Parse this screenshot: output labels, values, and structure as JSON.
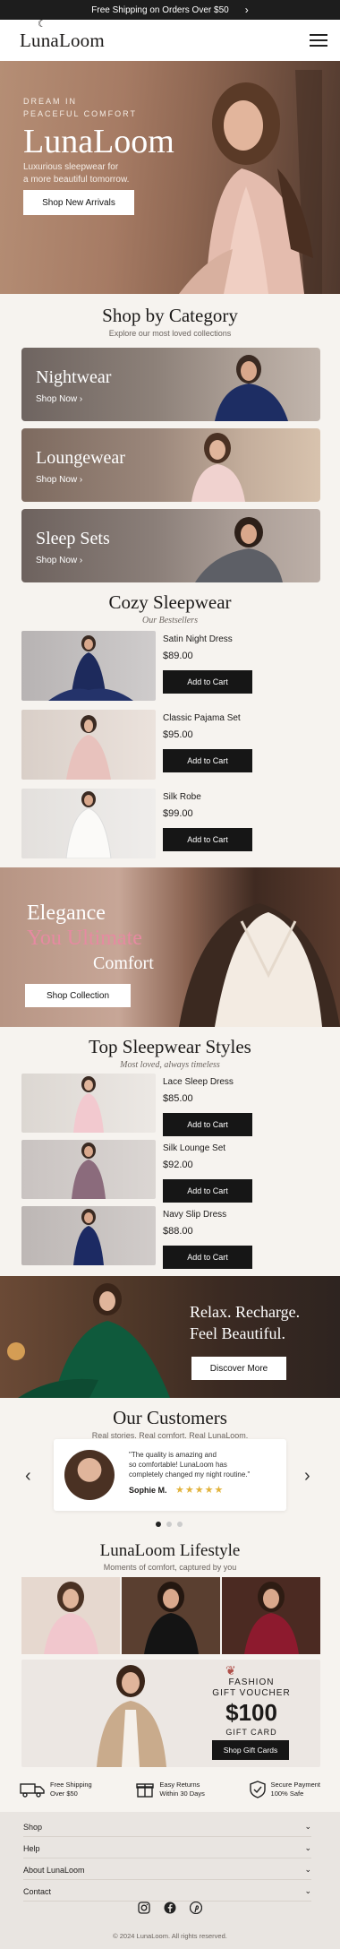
{
  "announcement": {
    "text": "Free Shipping on Orders Over $50",
    "arrow": "›"
  },
  "header": {
    "logo": "LunaLoom",
    "moon": "☾"
  },
  "hero": {
    "kicker_line1": "DREAM IN",
    "kicker_line2": "PEACEFUL COMFORT",
    "title": "LunaLoom",
    "sub_line1": "Luxurious sleepwear for",
    "sub_line2": "a more beautiful tomorrow.",
    "cta": "Shop New Arrivals"
  },
  "categories": {
    "title": "Shop by Category",
    "subtitle": "Explore our most loved collections",
    "items": [
      {
        "name": "Nightwear",
        "link": "Shop Now  ›"
      },
      {
        "name": "Loungewear",
        "link": "Shop Now  ›"
      },
      {
        "name": "Sleep Sets",
        "link": "Shop Now  ›"
      }
    ]
  },
  "cozy": {
    "title": "Cozy Sleepwear",
    "subtitle": "Our Bestsellers",
    "products": [
      {
        "name": "Satin Night Dress",
        "price": "$89.00",
        "cta": "Add to Cart"
      },
      {
        "name": "Classic Pajama Set",
        "price": "$95.00",
        "cta": "Add to Cart"
      },
      {
        "name": "Silk Robe",
        "price": "$99.00",
        "cta": "Add to Cart"
      }
    ]
  },
  "elegance": {
    "line1": "Elegance",
    "line2": "You Ultimate",
    "line3": "Comfort",
    "cta": "Shop Collection"
  },
  "styles": {
    "title": "Top Sleepwear Styles",
    "subtitle": "Most loved, always timeless",
    "products": [
      {
        "name": "Lace Sleep Dress",
        "price": "$85.00",
        "cta": "Add to Cart"
      },
      {
        "name": "Silk Lounge Set",
        "price": "$92.00",
        "cta": "Add to Cart"
      },
      {
        "name": "Navy Slip Dress",
        "price": "$88.00",
        "cta": "Add to Cart"
      }
    ]
  },
  "relax": {
    "line1": "Relax. Recharge.",
    "line2": "Feel Beautiful.",
    "cta": "Discover More"
  },
  "customers": {
    "title": "Our Customers",
    "subtitle": "Real stories. Real comfort. Real LunaLoom.",
    "quote_line1": "\"The quality is amazing and",
    "quote_line2": "so comfortable! LunaLoom has",
    "quote_line3": "completely changed my night routine.\"",
    "author": "Sophie M.",
    "stars": "★★★★★"
  },
  "lifestyle": {
    "title": "LunaLoom Lifestyle",
    "subtitle": "Moments of comfort, captured by you"
  },
  "voucher": {
    "line1": "FASHION",
    "line2": "GIFT VOUCHER",
    "amount": "$100",
    "line3": "GIFT CARD",
    "cta": "Shop Gift Cards"
  },
  "perks": [
    {
      "l1": "Free Shipping",
      "l2": "Over $50"
    },
    {
      "l1": "Easy Returns",
      "l2": "Within 30 Days"
    },
    {
      "l1": "Secure Payment",
      "l2": "100% Safe"
    }
  ],
  "footer": {
    "links": [
      "Shop",
      "Help",
      "About LunaLoom",
      "Contact"
    ],
    "copyright": "© 2024 LunaLoom. All rights reserved."
  },
  "colors": {
    "accent_pink": "#e68aa1",
    "dark_button": "#161616",
    "star_gold": "#e2b33c"
  }
}
